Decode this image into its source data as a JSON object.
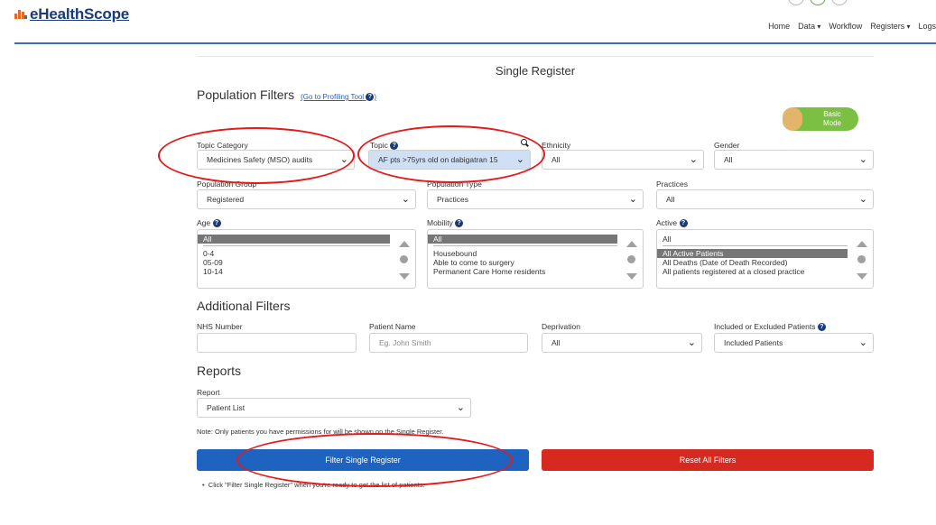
{
  "brand": {
    "name": "eHealthScope"
  },
  "nav": {
    "items": [
      "Home",
      "Data",
      "Workflow",
      "Registers",
      "Logs"
    ]
  },
  "page_title": "Single Register",
  "population_filters": {
    "title": "Population Filters",
    "link": "(Go to Profiling Tool",
    "link_end": ")",
    "mode_toggle": [
      "Basic",
      "Mode"
    ]
  },
  "fields": {
    "topic_category": {
      "label": "Topic Category",
      "value": "Medicines Safety (MSO) audits"
    },
    "topic": {
      "label": "Topic",
      "value": "AF pts >75yrs old on dabigatran 15"
    },
    "ethnicity": {
      "label": "Ethnicity",
      "value": "All"
    },
    "gender": {
      "label": "Gender",
      "value": "All"
    },
    "population_group": {
      "label": "Population Group",
      "value": "Registered"
    },
    "population_type": {
      "label": "Population Type",
      "value": "Practices"
    },
    "practices": {
      "label": "Practices",
      "value": "All"
    }
  },
  "lists": {
    "age": {
      "label": "Age",
      "selected": "All",
      "options": [
        "0-4",
        "05-09",
        "10-14"
      ]
    },
    "mobility": {
      "label": "Mobility",
      "selected": "All",
      "options": [
        "Housebound",
        "Able to come to surgery",
        "Permanent Care Home residents"
      ]
    },
    "active": {
      "label": "Active",
      "top": "All",
      "selected": "All Active Patients",
      "options": [
        "All Deaths (Date of Death Recorded)",
        "All patients registered at a closed practice"
      ]
    }
  },
  "additional_filters": {
    "title": "Additional Filters",
    "nhs_number": {
      "label": "NHS Number",
      "value": ""
    },
    "patient_name": {
      "label": "Patient Name",
      "placeholder": "Eg. John Smith"
    },
    "deprivation": {
      "label": "Deprivation",
      "value": "All"
    },
    "included": {
      "label": "Included or Excluded Patients",
      "value": "Included Patients"
    }
  },
  "reports": {
    "title": "Reports",
    "report": {
      "label": "Report",
      "value": "Patient List"
    }
  },
  "note": "Note: Only patients you have permissions for will be shown on the Single Register.",
  "buttons": {
    "filter": "Filter Single Register",
    "reset": "Reset All Filters"
  },
  "hint": "Click \"Filter Single Register\" when you're ready to get the list of patients.",
  "colors": {
    "primary": "#1e63c0",
    "danger": "#d62a20",
    "toggle": "#7bc043",
    "annotation": "#e31b1b"
  }
}
